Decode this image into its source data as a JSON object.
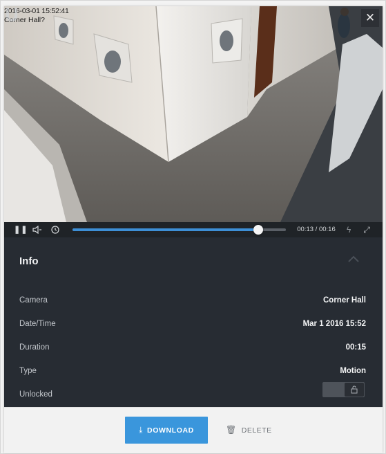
{
  "overlay": {
    "timestamp": "2016-03-01 15:52:41",
    "camera_label": "Corner Hall?"
  },
  "video": {
    "close_icon": "close-icon",
    "watermark": "ubiquiti-u-logo"
  },
  "controls": {
    "pause_icon": "pause-icon",
    "volume_icon": "volume-icon",
    "clock_icon": "clock-icon",
    "progress_fraction": 0.87,
    "time": "00:13 / 00:16",
    "bolt_icon": "bolt-icon",
    "fullscreen_icon": "expand-icon"
  },
  "info": {
    "title": "Info",
    "collapse_icon": "chevron-up-icon",
    "rows": [
      {
        "label": "Camera",
        "value": "Corner Hall"
      },
      {
        "label": "Date/Time",
        "value": "Mar 1 2016 15:52"
      },
      {
        "label": "Duration",
        "value": "00:15"
      },
      {
        "label": "Type",
        "value": "Motion"
      },
      {
        "label": "Unlocked",
        "value": ""
      }
    ],
    "unlocked_state": false,
    "lock_icon": "lock-icon"
  },
  "footer": {
    "download_label": "DOWNLOAD",
    "download_icon": "download-icon",
    "delete_label": "DELETE",
    "delete_icon": "trash-icon"
  },
  "colors": {
    "accent": "#3a96dc",
    "panel": "#272c33",
    "progress": "#3d8fd6"
  }
}
